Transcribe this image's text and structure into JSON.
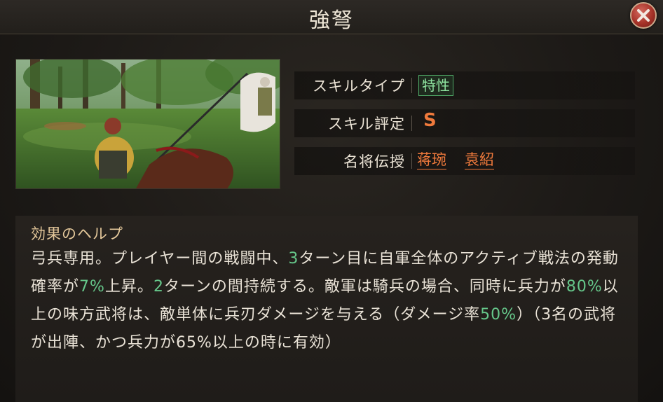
{
  "dialog": {
    "title": "強弩"
  },
  "skill_image": {
    "description_icon": "battle-scene-image"
  },
  "info": {
    "type_label": "スキルタイプ",
    "type_value": "特性",
    "rank_label": "スキル評定",
    "rank_value": "S",
    "teach_label": "名将伝授",
    "generals": [
      "蒋琬",
      "袁紹"
    ]
  },
  "help": {
    "title": "効果のヘルプ",
    "segments": [
      {
        "t": "弓兵専用。プレイヤー間の戦闘中、"
      },
      {
        "t": "3",
        "hl": true
      },
      {
        "t": "ターン目に自軍全体のアクティブ戦法の発動確率が"
      },
      {
        "t": "7%",
        "hl": true
      },
      {
        "t": "上昇。"
      },
      {
        "t": "2",
        "hl": true
      },
      {
        "t": "ターンの間持続する。敵軍は騎兵の場合、同時に兵力が"
      },
      {
        "t": "80%",
        "hl": true
      },
      {
        "t": "以上の味方武将は、敵単体に兵刃ダメージを与える（ダメージ率"
      },
      {
        "t": "50%",
        "hl": true
      },
      {
        "t": "）（3名の武将が出陣、かつ兵力が65%以上の時に有効）"
      }
    ]
  },
  "colors": {
    "highlight": "#66c78a",
    "rank": "#f07a3c",
    "type_badge": "#4fa866"
  }
}
